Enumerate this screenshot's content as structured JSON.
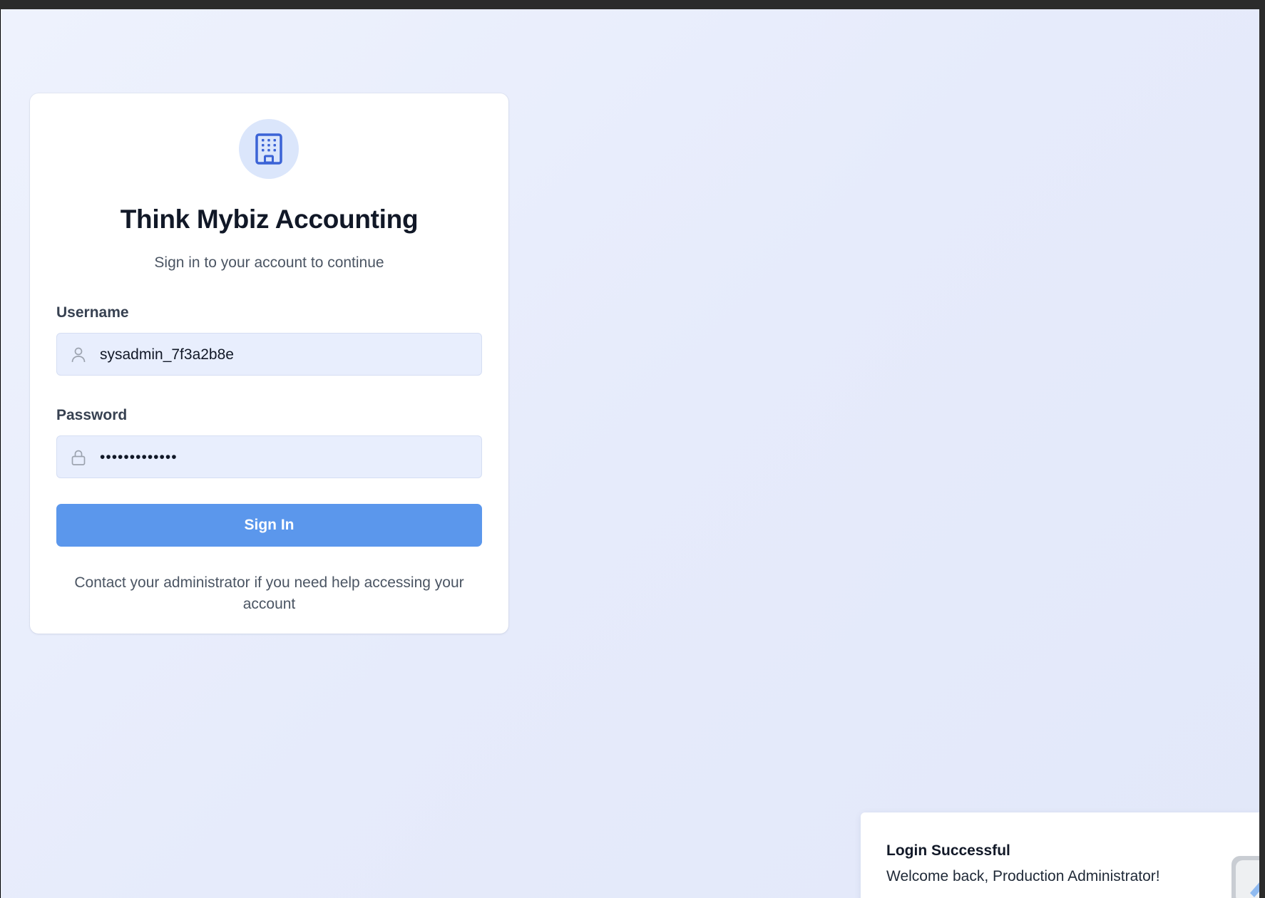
{
  "login": {
    "title": "Think Mybiz Accounting",
    "subtitle": "Sign in to your account to continue",
    "username_label": "Username",
    "username_value": "sysadmin_7f3a2b8e",
    "password_label": "Password",
    "password_value": "•••••••••••••",
    "signin_label": "Sign In",
    "help_text": "Contact your administrator if you need help accessing your account"
  },
  "toast": {
    "title": "Login Successful",
    "message": "Welcome back, Production Administrator!"
  },
  "icons": {
    "logo": "building-icon",
    "username": "user-icon",
    "password": "lock-icon"
  },
  "colors": {
    "accent": "#5b97ec",
    "logo_bg": "#dbe6fb",
    "logo_fg": "#3b63d6",
    "input_bg": "#e8eefd"
  }
}
